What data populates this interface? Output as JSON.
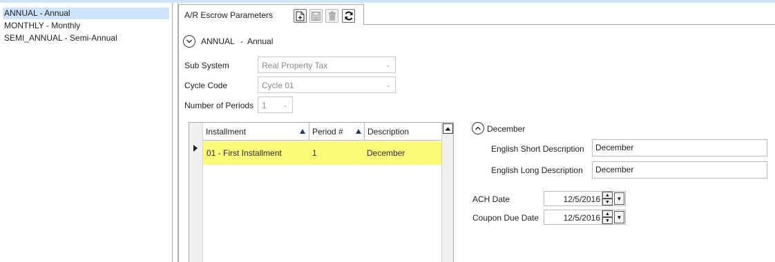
{
  "cycle_list": {
    "items": [
      {
        "label": "ANNUAL - Annual",
        "selected": true
      },
      {
        "label": "MONTHLY - Monthly",
        "selected": false
      },
      {
        "label": "SEMI_ANNUAL - Semi-Annual",
        "selected": false
      }
    ]
  },
  "tab": {
    "title": "A/R Escrow Parameters",
    "toolbar": [
      {
        "icon": "new-document-icon",
        "enabled": true
      },
      {
        "icon": "save-icon",
        "enabled": false
      },
      {
        "icon": "delete-icon",
        "enabled": false
      },
      {
        "icon": "refresh-icon",
        "enabled": true
      }
    ]
  },
  "section_header": {
    "code": "ANNUAL",
    "separator": "-",
    "description": "Annual"
  },
  "form": {
    "sub_system_label": "Sub System",
    "sub_system_value": "Real Property Tax",
    "cycle_code_label": "Cycle Code",
    "cycle_code_value": "Cycle 01",
    "periods_label": "Number of Periods",
    "periods_value": "1"
  },
  "grid": {
    "columns": [
      "Installment",
      "Period #",
      "Description"
    ],
    "rows": [
      {
        "installment": "01 - First Installment",
        "period": "1",
        "description": "December"
      }
    ]
  },
  "detail": {
    "header": "December",
    "short_desc_label": "English Short Description",
    "short_desc_value": "December",
    "long_desc_label": "English Long Description",
    "long_desc_value": "December",
    "ach_date_label": "ACH Date",
    "ach_date_value": "12/5/2016",
    "coupon_due_label": "Coupon Due Date",
    "coupon_due_value": "12/5/2016"
  },
  "colors": {
    "selection": "#cde3f7",
    "row_highlight": "#fbfb72",
    "border": "#a9a9a9"
  }
}
